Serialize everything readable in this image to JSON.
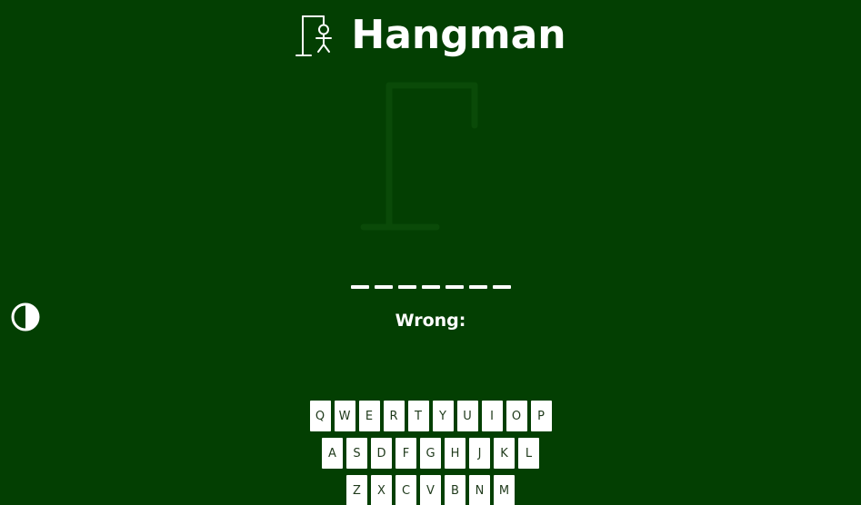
{
  "header": {
    "title": "Hangman",
    "logo_icon": "hangman-logo-icon"
  },
  "game": {
    "word_slots": [
      "",
      "",
      "",
      "",
      "",
      "",
      ""
    ],
    "wrong_label": "Wrong:"
  },
  "theme_toggle": {
    "icon": "contrast-icon"
  },
  "keyboard": {
    "row1": [
      "Q",
      "W",
      "E",
      "R",
      "T",
      "Y",
      "U",
      "I",
      "O",
      "P"
    ],
    "row2": [
      "A",
      "S",
      "D",
      "F",
      "G",
      "H",
      "J",
      "K",
      "L"
    ],
    "row3": [
      "Z",
      "X",
      "C",
      "V",
      "B",
      "N",
      "M"
    ]
  },
  "colors": {
    "background": "#033f02",
    "foreground": "#ffffff",
    "key_text": "#1f3a1b",
    "gallows_faint": "#0a4a08"
  }
}
